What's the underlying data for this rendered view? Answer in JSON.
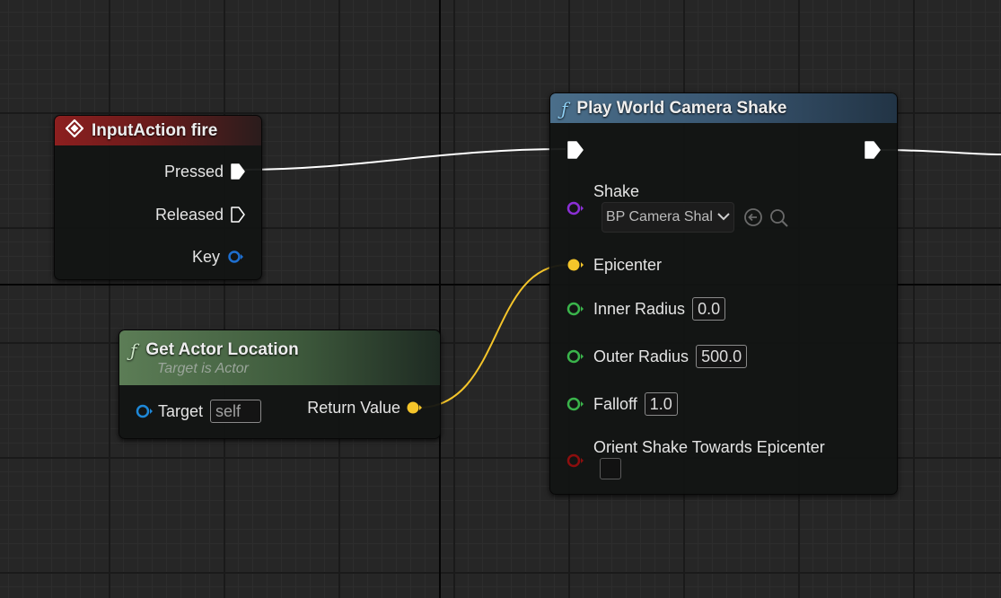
{
  "graph": {
    "input_action_node": {
      "title": "InputAction fire",
      "pins": {
        "pressed": "Pressed",
        "released": "Released",
        "key": "Key"
      }
    },
    "get_actor_location_node": {
      "title": "Get Actor Location",
      "subtitle": "Target is Actor",
      "target_label": "Target",
      "target_value": "self",
      "return_label": "Return Value"
    },
    "camera_shake_node": {
      "title": "Play World Camera Shake",
      "shake_label": "Shake",
      "shake_class_value": "BP Camera Shal",
      "epicenter_label": "Epicenter",
      "inner_radius_label": "Inner Radius",
      "inner_radius_value": "0.0",
      "outer_radius_label": "Outer Radius",
      "outer_radius_value": "500.0",
      "falloff_label": "Falloff",
      "falloff_value": "1.0",
      "orient_label": "Orient Shake Towards Epicenter",
      "orient_checked": false
    }
  },
  "colors": {
    "event_header": "#8c1f1f",
    "function_header": "#3e5f78",
    "pure_function_header": "#4f6e4a",
    "exec_wire": "#ffffff",
    "vector_pin": "#f5c52a",
    "float_pin": "#3ab44b",
    "object_pin": "#1e88d8",
    "class_pin": "#8b2fd6",
    "bool_pin": "#8c0e0e"
  },
  "icons": {
    "event": "diamond-event-icon",
    "function": "function-f-icon",
    "use_selected": "arrow-left-circle-icon",
    "browse": "search-icon",
    "dropdown": "chevron-down-icon"
  }
}
